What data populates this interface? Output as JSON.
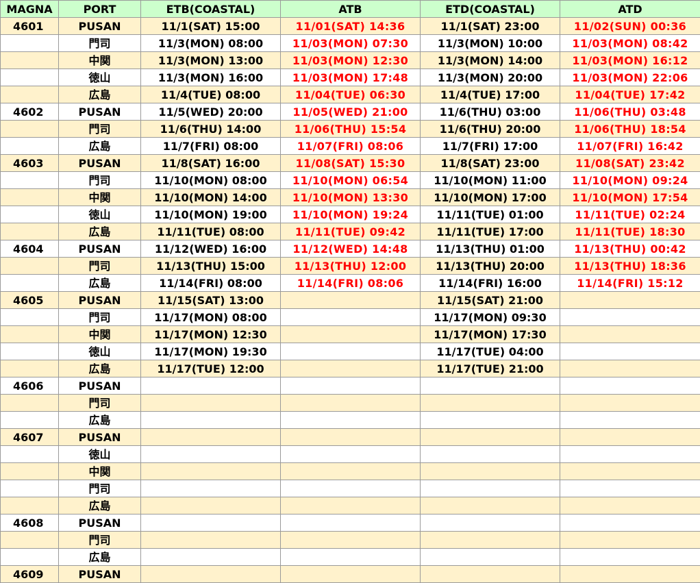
{
  "headers": [
    "MAGNA",
    "PORT",
    "ETB(COASTAL)",
    "ATB",
    "ETD(COASTAL)",
    "ATD"
  ],
  "colors": {
    "header_bg": "#ccffcc",
    "alt_row_bg": "#fff2cc",
    "row_bg": "#ffffff",
    "actual_text": "#ff0000",
    "grid": "#9a9a9a"
  },
  "rows": [
    {
      "magna": "4601",
      "port": "PUSAN",
      "etb": "11/1(SAT) 15:00",
      "atb": "11/01(SAT) 14:36",
      "etd": "11/1(SAT) 23:00",
      "atd": "11/02(SUN) 00:36"
    },
    {
      "magna": "",
      "port": "門司",
      "etb": "11/3(MON) 08:00",
      "atb": "11/03(MON) 07:30",
      "etd": "11/3(MON) 10:00",
      "atd": "11/03(MON) 08:42"
    },
    {
      "magna": "",
      "port": "中関",
      "etb": "11/3(MON) 13:00",
      "atb": "11/03(MON) 12:30",
      "etd": "11/3(MON) 14:00",
      "atd": "11/03(MON) 16:12"
    },
    {
      "magna": "",
      "port": "徳山",
      "etb": "11/3(MON) 16:00",
      "atb": "11/03(MON) 17:48",
      "etd": "11/3(MON) 20:00",
      "atd": "11/03(MON) 22:06"
    },
    {
      "magna": "",
      "port": "広島",
      "etb": "11/4(TUE) 08:00",
      "atb": "11/04(TUE) 06:30",
      "etd": "11/4(TUE) 17:00",
      "atd": "11/04(TUE) 17:42"
    },
    {
      "magna": "4602",
      "port": "PUSAN",
      "etb": "11/5(WED) 20:00",
      "atb": "11/05(WED) 21:00",
      "etd": "11/6(THU) 03:00",
      "atd": "11/06(THU) 03:48"
    },
    {
      "magna": "",
      "port": "門司",
      "etb": "11/6(THU) 14:00",
      "atb": "11/06(THU) 15:54",
      "etd": "11/6(THU) 20:00",
      "atd": "11/06(THU) 18:54"
    },
    {
      "magna": "",
      "port": "広島",
      "etb": "11/7(FRI) 08:00",
      "atb": "11/07(FRI) 08:06",
      "etd": "11/7(FRI) 17:00",
      "atd": "11/07(FRI) 16:42"
    },
    {
      "magna": "4603",
      "port": "PUSAN",
      "etb": "11/8(SAT) 16:00",
      "atb": "11/08(SAT) 15:30",
      "etd": "11/8(SAT) 23:00",
      "atd": "11/08(SAT) 23:42"
    },
    {
      "magna": "",
      "port": "門司",
      "etb": "11/10(MON) 08:00",
      "atb": "11/10(MON) 06:54",
      "etd": "11/10(MON) 11:00",
      "atd": "11/10(MON) 09:24"
    },
    {
      "magna": "",
      "port": "中関",
      "etb": "11/10(MON) 14:00",
      "atb": "11/10(MON) 13:30",
      "etd": "11/10(MON) 17:00",
      "atd": "11/10(MON) 17:54"
    },
    {
      "magna": "",
      "port": "徳山",
      "etb": "11/10(MON) 19:00",
      "atb": "11/10(MON) 19:24",
      "etd": "11/11(TUE) 01:00",
      "atd": "11/11(TUE) 02:24"
    },
    {
      "magna": "",
      "port": "広島",
      "etb": "11/11(TUE) 08:00",
      "atb": "11/11(TUE) 09:42",
      "etd": "11/11(TUE) 17:00",
      "atd": "11/11(TUE) 18:30"
    },
    {
      "magna": "4604",
      "port": "PUSAN",
      "etb": "11/12(WED) 16:00",
      "atb": "11/12(WED) 14:48",
      "etd": "11/13(THU) 01:00",
      "atd": "11/13(THU) 00:42"
    },
    {
      "magna": "",
      "port": "門司",
      "etb": "11/13(THU) 15:00",
      "atb": "11/13(THU) 12:00",
      "etd": "11/13(THU) 20:00",
      "atd": "11/13(THU) 18:36"
    },
    {
      "magna": "",
      "port": "広島",
      "etb": "11/14(FRI) 08:00",
      "atb": "11/14(FRI) 08:06",
      "etd": "11/14(FRI) 16:00",
      "atd": "11/14(FRI) 15:12"
    },
    {
      "magna": "4605",
      "port": "PUSAN",
      "etb": "11/15(SAT) 13:00",
      "atb": "",
      "etd": "11/15(SAT) 21:00",
      "atd": ""
    },
    {
      "magna": "",
      "port": "門司",
      "etb": "11/17(MON) 08:00",
      "atb": "",
      "etd": "11/17(MON) 09:30",
      "atd": ""
    },
    {
      "magna": "",
      "port": "中関",
      "etb": "11/17(MON) 12:30",
      "atb": "",
      "etd": "11/17(MON) 17:30",
      "atd": ""
    },
    {
      "magna": "",
      "port": "徳山",
      "etb": "11/17(MON) 19:30",
      "atb": "",
      "etd": "11/17(TUE) 04:00",
      "atd": ""
    },
    {
      "magna": "",
      "port": "広島",
      "etb": "11/17(TUE) 12:00",
      "atb": "",
      "etd": "11/17(TUE) 21:00",
      "atd": ""
    },
    {
      "magna": "4606",
      "port": "PUSAN",
      "etb": "",
      "atb": "",
      "etd": "",
      "atd": ""
    },
    {
      "magna": "",
      "port": "門司",
      "etb": "",
      "atb": "",
      "etd": "",
      "atd": ""
    },
    {
      "magna": "",
      "port": "広島",
      "etb": "",
      "atb": "",
      "etd": "",
      "atd": ""
    },
    {
      "magna": "4607",
      "port": "PUSAN",
      "etb": "",
      "atb": "",
      "etd": "",
      "atd": ""
    },
    {
      "magna": "",
      "port": "徳山",
      "etb": "",
      "atb": "",
      "etd": "",
      "atd": ""
    },
    {
      "magna": "",
      "port": "中関",
      "etb": "",
      "atb": "",
      "etd": "",
      "atd": ""
    },
    {
      "magna": "",
      "port": "門司",
      "etb": "",
      "atb": "",
      "etd": "",
      "atd": ""
    },
    {
      "magna": "",
      "port": "広島",
      "etb": "",
      "atb": "",
      "etd": "",
      "atd": ""
    },
    {
      "magna": "4608",
      "port": "PUSAN",
      "etb": "",
      "atb": "",
      "etd": "",
      "atd": ""
    },
    {
      "magna": "",
      "port": "門司",
      "etb": "",
      "atb": "",
      "etd": "",
      "atd": ""
    },
    {
      "magna": "",
      "port": "広島",
      "etb": "",
      "atb": "",
      "etd": "",
      "atd": ""
    },
    {
      "magna": "4609",
      "port": "PUSAN",
      "etb": "",
      "atb": "",
      "etd": "",
      "atd": ""
    }
  ]
}
